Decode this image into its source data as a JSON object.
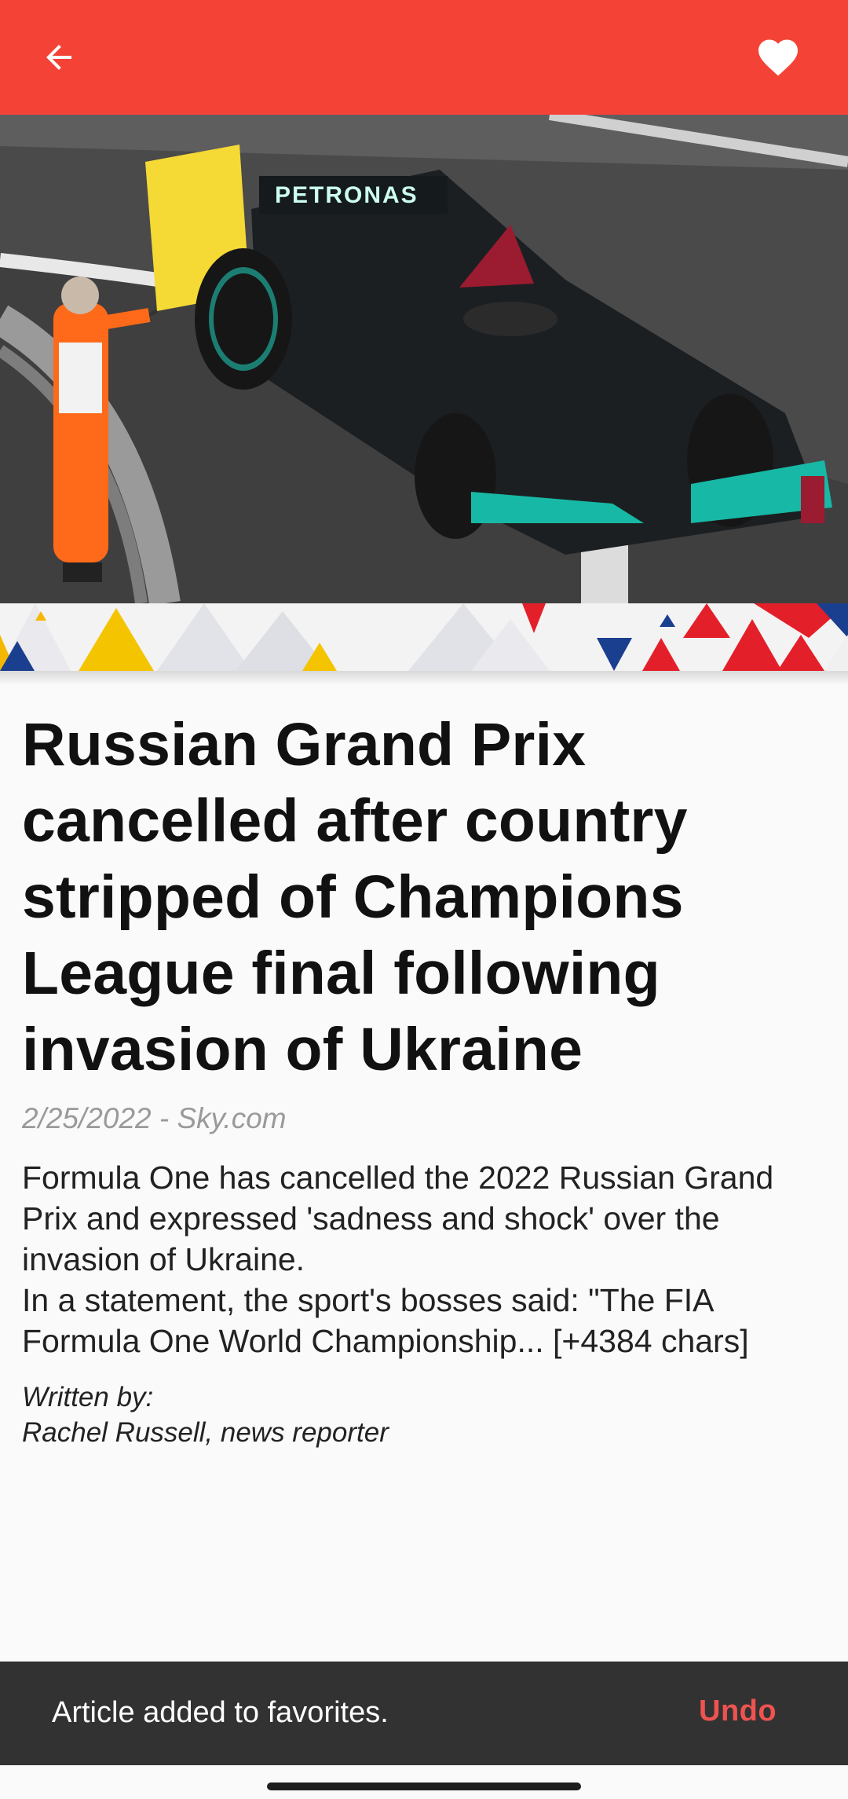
{
  "appbar": {
    "back_icon": "arrow-back-icon",
    "favorite_icon": "heart-filled-icon",
    "color": "#f44336"
  },
  "article": {
    "title": "Russian Grand Prix cancelled after country stripped of Champions League final following invasion of Ukraine",
    "meta": "2/25/2022 - Sky.com",
    "body_line1": "Formula One has cancelled the 2022 Russian Grand Prix and expressed 'sadness and shock' over the invasion of Ukraine.",
    "body_line2": "In a statement, the sport's bosses said: \"The FIA Formula One World Championship... [+4384 chars]",
    "written_by_label": "Written by:",
    "author": "Rachel Russell, news reporter"
  },
  "snackbar": {
    "message": "Article added to favorites.",
    "action": "Undo",
    "action_color": "#ef5350"
  }
}
